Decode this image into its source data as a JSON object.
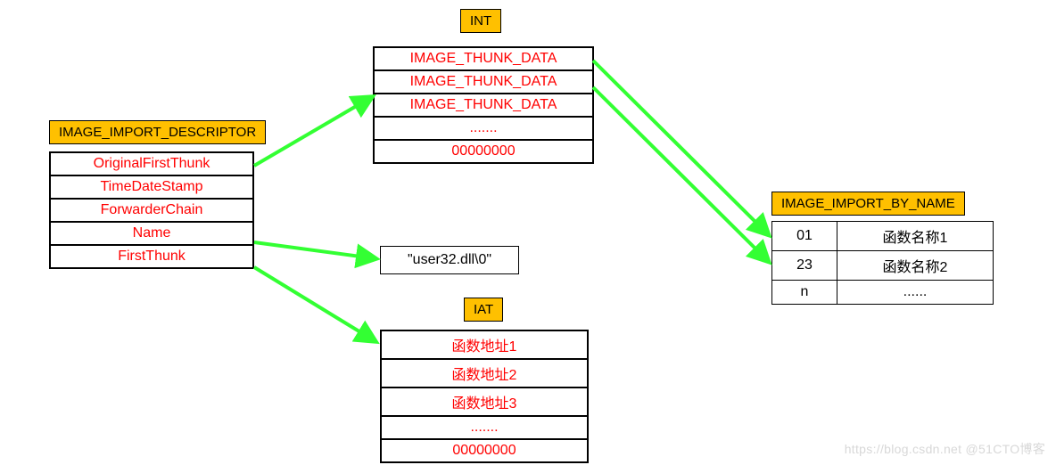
{
  "descriptor": {
    "title": "IMAGE_IMPORT_DESCRIPTOR",
    "rows": [
      "OriginalFirstThunk",
      "TimeDateStamp",
      "ForwarderChain",
      "Name",
      "FirstThunk"
    ]
  },
  "int_table": {
    "title": "INT",
    "rows": [
      "IMAGE_THUNK_DATA",
      "IMAGE_THUNK_DATA",
      "IMAGE_THUNK_DATA",
      ".......",
      "00000000"
    ]
  },
  "name_box": "\"user32.dll\\0\"",
  "iat_table": {
    "title": "IAT",
    "rows": [
      "函数地址1",
      "函数地址2",
      "函数地址3",
      ".......",
      "00000000"
    ]
  },
  "import_by_name": {
    "title": "IMAGE_IMPORT_BY_NAME",
    "rows": [
      {
        "ordinal": "01",
        "name": "函数名称1"
      },
      {
        "ordinal": "23",
        "name": "函数名称2"
      },
      {
        "ordinal": "n",
        "name": "......"
      }
    ]
  },
  "watermark": "https://blog.csdn.net  @51CTO博客",
  "colors": {
    "accent": "#ffc000",
    "text_red": "#ff0000",
    "arrow": "#33ff33"
  }
}
